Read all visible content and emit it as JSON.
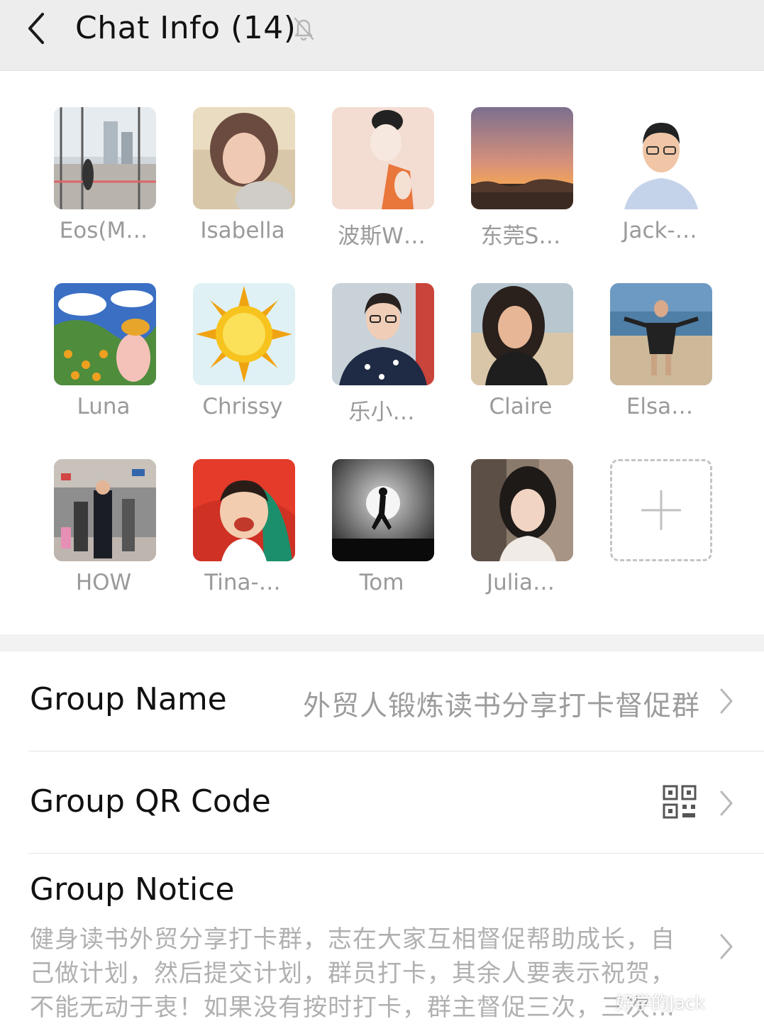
{
  "header": {
    "title": "Chat Info (14)",
    "back_icon": "chevron-left-icon",
    "mute_icon": "bell-off-icon"
  },
  "members": [
    {
      "name": "Eos(M…",
      "avatar": "city-bridge-photo"
    },
    {
      "name": "Isabella",
      "avatar": "woman-portrait-photo"
    },
    {
      "name": "波斯W…",
      "avatar": "illustration-girl"
    },
    {
      "name": "东莞S…",
      "avatar": "sunset-photo"
    },
    {
      "name": "Jack-…",
      "avatar": "man-glasses-photo"
    },
    {
      "name": "Luna",
      "avatar": "flower-field-illustration"
    },
    {
      "name": "Chrissy",
      "avatar": "sun-illustration"
    },
    {
      "name": "乐小…",
      "avatar": "woman-glasses-photo"
    },
    {
      "name": "Claire",
      "avatar": "woman-beach-photo"
    },
    {
      "name": "Elsa…",
      "avatar": "beach-pose-photo"
    },
    {
      "name": "HOW",
      "avatar": "crowd-station-photo"
    },
    {
      "name": "Tina-…",
      "avatar": "child-smile-photo"
    },
    {
      "name": "Tom",
      "avatar": "runner-moon-silhouette"
    },
    {
      "name": "Julia…",
      "avatar": "girl-bob-photo"
    }
  ],
  "add_member": {
    "icon": "plus-icon"
  },
  "settings": {
    "group_name": {
      "label": "Group Name",
      "value": "外贸人锻炼读书分享打卡督促群"
    },
    "group_qr": {
      "label": "Group QR Code",
      "icon": "qr-code-icon"
    },
    "group_notice": {
      "label": "Group Notice",
      "text": "健身读书外贸分享打卡群，志在大家互相督促帮助成长，自己做计划，然后提交计划，群员打卡，其余人要表示祝贺，不能无动于衷！如果没有按时打卡，群主督促三次，三次…"
    }
  },
  "watermark": "好学的Jack",
  "colors": {
    "header_bg": "#ededed",
    "name_gray": "#9a9a9a",
    "value_gray": "#9c9c9c",
    "band_gray": "#f2f2f2"
  }
}
